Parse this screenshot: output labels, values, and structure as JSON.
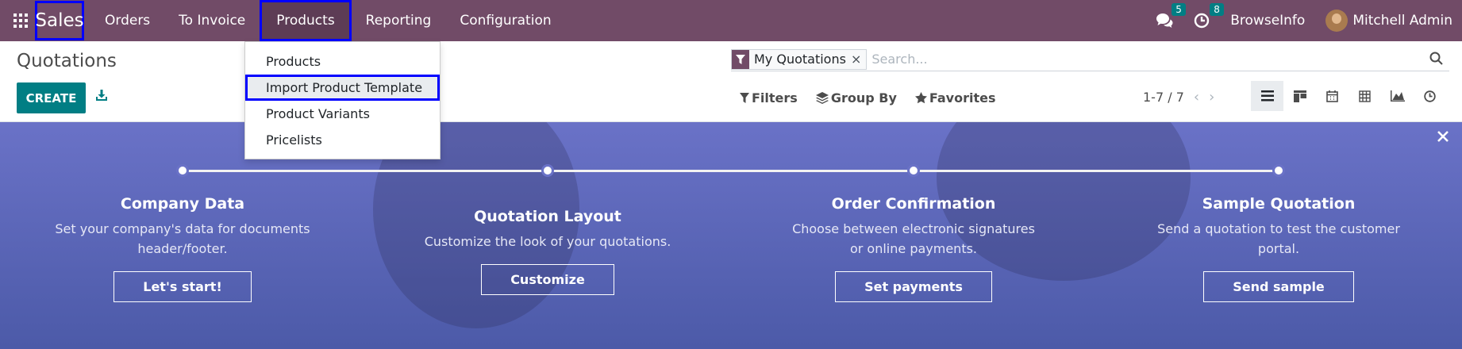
{
  "app": {
    "brand": "Sales"
  },
  "navbar": {
    "menu": [
      {
        "label": "Orders"
      },
      {
        "label": "To Invoice"
      },
      {
        "label": "Products"
      },
      {
        "label": "Reporting"
      },
      {
        "label": "Configuration"
      }
    ],
    "messages_count": "5",
    "activities_count": "8",
    "company": "BrowseInfo",
    "user": "Mitchell Admin"
  },
  "dropdown": {
    "items": [
      {
        "label": "Products"
      },
      {
        "label": "Import Product Template"
      },
      {
        "label": "Product Variants"
      },
      {
        "label": "Pricelists"
      }
    ]
  },
  "control": {
    "title": "Quotations",
    "create_label": "CREATE",
    "facet_label": "My Quotations",
    "search_placeholder": "Search...",
    "filters_label": "Filters",
    "groupby_label": "Group By",
    "favorites_label": "Favorites",
    "pager": "1-7 / 7"
  },
  "banner": {
    "steps": [
      {
        "title": "Company Data",
        "desc1": "Set your company's data for documents",
        "desc2": "header/footer.",
        "button": "Let's start!"
      },
      {
        "title": "Quotation Layout",
        "desc1": "Customize the look of your quotations.",
        "desc2": "",
        "button": "Customize"
      },
      {
        "title": "Order Confirmation",
        "desc1": "Choose between electronic signatures",
        "desc2": "or online payments.",
        "button": "Set payments"
      },
      {
        "title": "Sample Quotation",
        "desc1": "Send a quotation to test the customer",
        "desc2": "portal.",
        "button": "Send sample"
      }
    ]
  },
  "colors": {
    "navbar": "#714B67",
    "primary": "#017e84",
    "banner": "#6a72c7",
    "highlight": "#0000ff"
  }
}
